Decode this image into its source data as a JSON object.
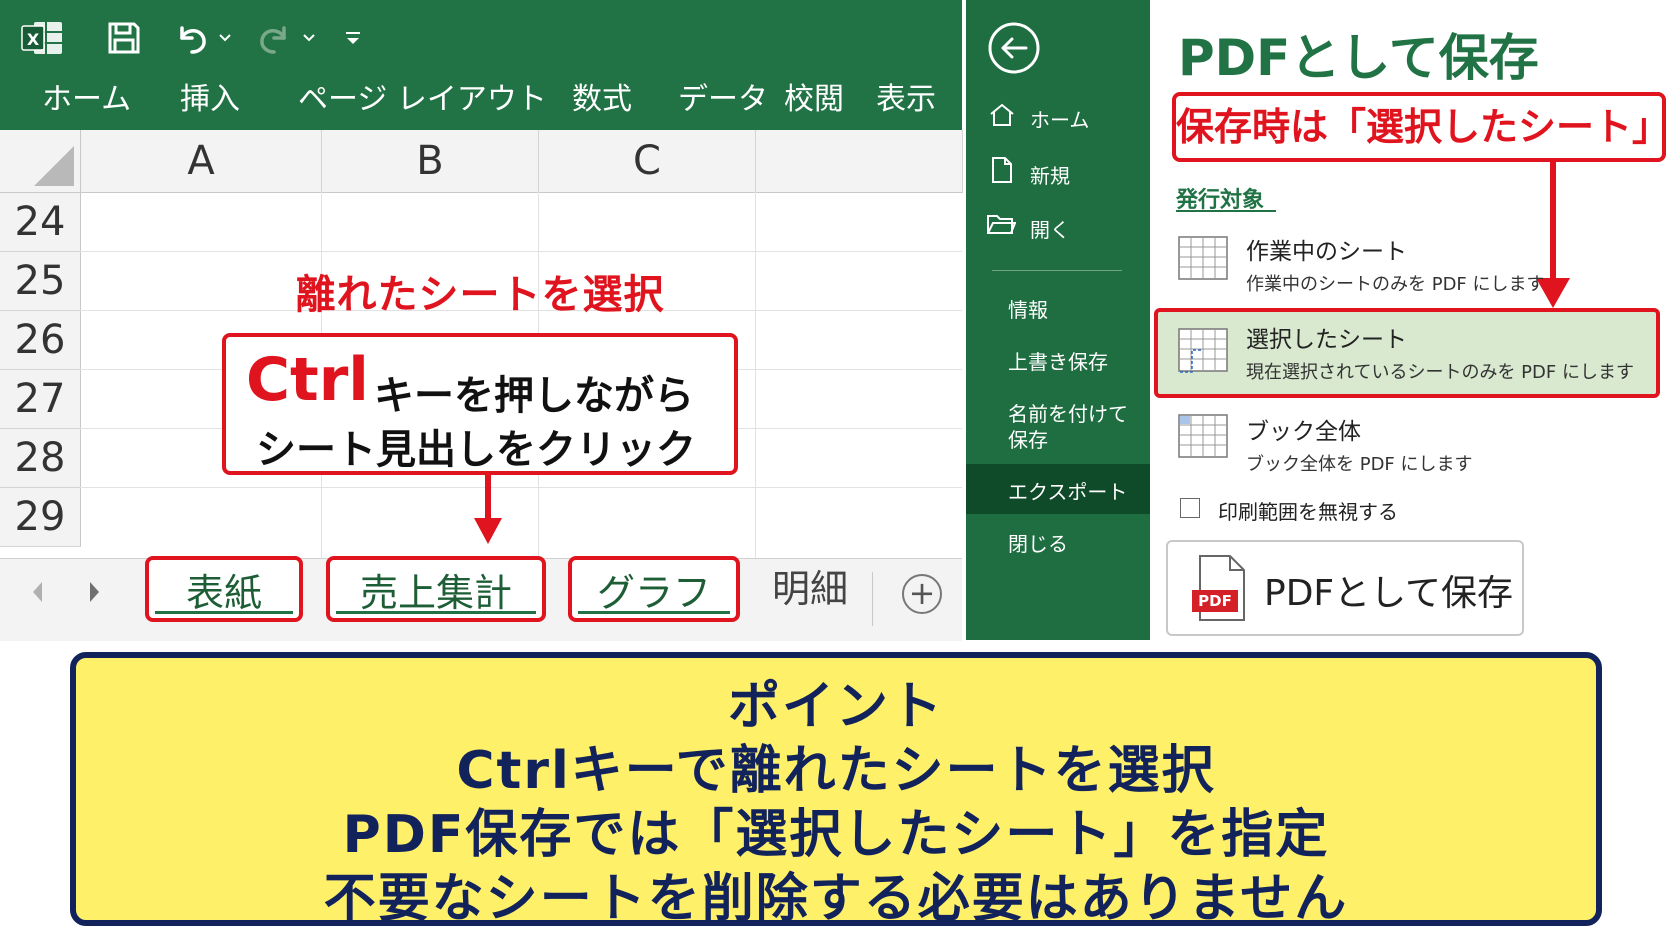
{
  "excel": {
    "tabs": [
      "ホーム",
      "挿入",
      "ページ レイアウト",
      "数式",
      "データ",
      "校閲",
      "表示"
    ],
    "columns": [
      "A",
      "B",
      "C"
    ],
    "rows": [
      "24",
      "25",
      "26",
      "27",
      "28",
      "29"
    ],
    "sheets": [
      "表紙",
      "売上集計",
      "グラフ",
      "明細"
    ],
    "add_sheet_symbol": "+"
  },
  "annotation": {
    "title": "離れたシートを選択",
    "ctrl": "Ctrl",
    "line1": "キーを押しながら",
    "line2": "シート見出しをクリック"
  },
  "backstage": {
    "nav": {
      "home": "ホーム",
      "new": "新規",
      "open": "開く",
      "info": "情報",
      "overwrite": "上書き保存",
      "saveas_1": "名前を付けて",
      "saveas_2": "保存",
      "export": "エクスポート",
      "close": "閉じる"
    },
    "title": "PDFとして保存",
    "callout": "保存時は「選択したシート」",
    "target_label": "発行対象",
    "options": [
      {
        "title": "作業中のシート",
        "desc": "作業中のシートのみを PDF にします"
      },
      {
        "title": "選択したシート",
        "desc": "現在選択されているシートのみを PDF にします"
      },
      {
        "title": "ブック全体",
        "desc": "ブック全体を PDF にします"
      }
    ],
    "ignore_print_area": "印刷範囲を無視する",
    "save_button": "PDFとして保存",
    "pdf_icon_text": "PDF"
  },
  "summary": {
    "lines": [
      "ポイント",
      "Ctrlキーで離れたシートを選択",
      "PDF保存では「選択したシート」を指定",
      "不要なシートを削除する必要はありません"
    ]
  },
  "colors": {
    "excel_green": "#217346",
    "accent_red": "#e0141e",
    "summary_bg": "#fff06a",
    "summary_text": "#12235b"
  }
}
